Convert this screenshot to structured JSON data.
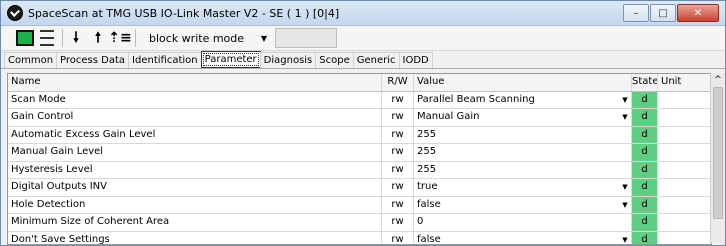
{
  "window": {
    "title": "SpaceScan at TMG USB IO-Link Master V2 - SE ( 1 ) [0|4]"
  },
  "window_buttons": {
    "minimize": "–",
    "maximize": "□",
    "close": "✕"
  },
  "toolbar": {
    "mode_value": "block write mode",
    "dropdown_glyph": "▼",
    "icons": [
      "green-device-icon",
      "list-icon",
      "down-arrow-icon",
      "up-arrow-icon",
      "sort-arrow-icon"
    ]
  },
  "tabs": [
    {
      "label": "Common"
    },
    {
      "label": "Process Data"
    },
    {
      "label": "Identification"
    },
    {
      "label": "Parameter",
      "active": true
    },
    {
      "label": "Diagnosis"
    },
    {
      "label": "Scope"
    },
    {
      "label": "Generic"
    },
    {
      "label": "IODD"
    }
  ],
  "grid": {
    "headers": {
      "name": "Name",
      "rw": "R/W",
      "value": "Value",
      "state": "State",
      "unit": "Unit"
    },
    "rows": [
      {
        "name": "Scan Mode",
        "rw": "rw",
        "value": "Parallel Beam Scanning",
        "dropdown": true,
        "state": "d",
        "unit": ""
      },
      {
        "name": "Gain Control",
        "rw": "rw",
        "value": "Manual Gain",
        "dropdown": true,
        "state": "d",
        "unit": ""
      },
      {
        "name": "Automatic Excess Gain Level",
        "rw": "rw",
        "value": "255",
        "dropdown": false,
        "state": "d",
        "unit": ""
      },
      {
        "name": "Manual Gain Level",
        "rw": "rw",
        "value": "255",
        "dropdown": false,
        "state": "d",
        "unit": ""
      },
      {
        "name": "Hysteresis Level",
        "rw": "rw",
        "value": "255",
        "dropdown": false,
        "state": "d",
        "unit": ""
      },
      {
        "name": "Digital Outputs INV",
        "rw": "rw",
        "value": "true",
        "dropdown": true,
        "state": "d",
        "unit": ""
      },
      {
        "name": "Hole Detection",
        "rw": "rw",
        "value": "false",
        "dropdown": true,
        "state": "d",
        "unit": ""
      },
      {
        "name": "Minimum Size of Coherent Area",
        "rw": "rw",
        "value": "0",
        "dropdown": false,
        "state": "d",
        "unit": ""
      },
      {
        "name": "Don't Save Settings",
        "rw": "rw",
        "value": "false",
        "dropdown": true,
        "state": "d",
        "unit": ""
      }
    ]
  },
  "colors": {
    "state_ok": "#5ecf82",
    "title_bar": "#c4d7ee"
  },
  "scrollbar": {
    "up_glyph": "^"
  }
}
